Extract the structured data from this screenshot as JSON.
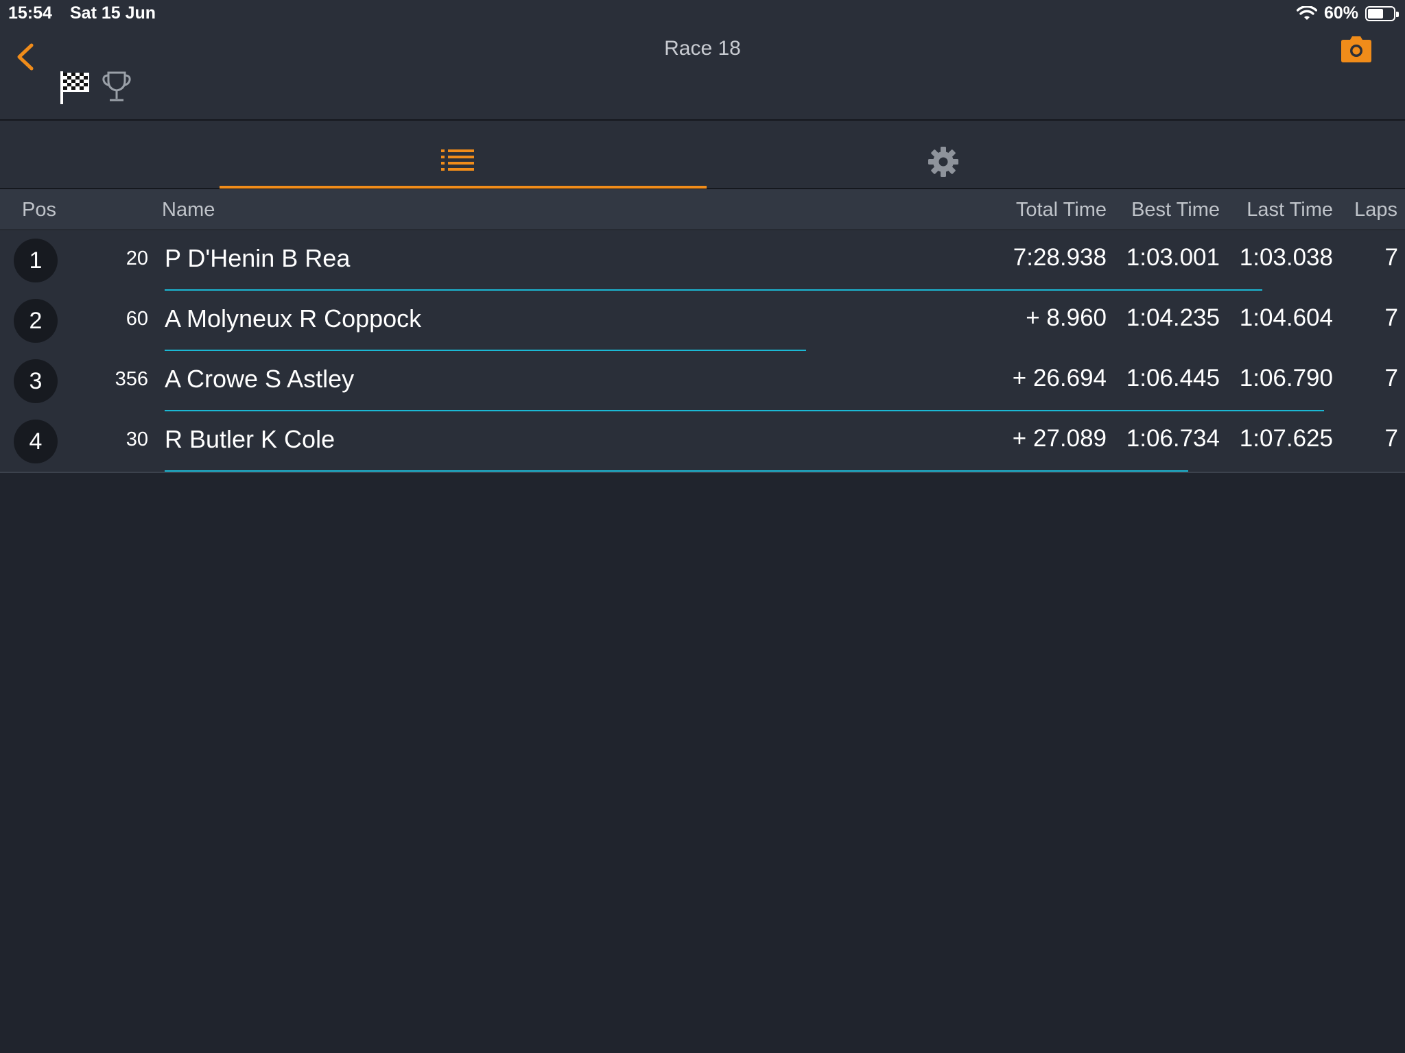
{
  "status_bar": {
    "time": "15:54",
    "date": "Sat 15 Jun",
    "battery": "60%",
    "battery_level": 0.6,
    "icons": [
      "wifi-icon",
      "battery-icon"
    ]
  },
  "nav": {
    "title": "Race 18",
    "icons": [
      "chevron-left-icon",
      "checkered-flag-icon",
      "trophy-icon",
      "camera-icon"
    ]
  },
  "tabs": [
    {
      "icon": "list-icon",
      "selected": true
    },
    {
      "icon": "gear-icon",
      "selected": false
    }
  ],
  "table": {
    "headers": {
      "pos": "Pos",
      "name": "Name",
      "total": "Total Time",
      "best": "Best Time",
      "last": "Last Time",
      "laps": "Laps"
    },
    "rows": [
      {
        "pos": "1",
        "number": "20",
        "name": "P D'Henin B Rea",
        "total": "7:28.938",
        "best": "1:03.001",
        "last": "1:03.038",
        "laps": "7",
        "progress": 0.89
      },
      {
        "pos": "2",
        "number": "60",
        "name": "A Molyneux R Coppock",
        "total": "+ 8.960",
        "best": "1:04.235",
        "last": "1:04.604",
        "laps": "7",
        "progress": 0.52
      },
      {
        "pos": "3",
        "number": "356",
        "name": "A Crowe S Astley",
        "total": "+ 26.694",
        "best": "1:06.445",
        "last": "1:06.790",
        "laps": "7",
        "progress": 0.94
      },
      {
        "pos": "4",
        "number": "30",
        "name": "R Butler K Cole",
        "total": "+ 27.089",
        "best": "1:06.734",
        "last": "1:07.625",
        "laps": "7",
        "progress": 0.83
      }
    ]
  },
  "colors": {
    "accent": "#f08c1a",
    "progress": "#1bb8d4",
    "background": "#20242d",
    "panel": "#2a2f39"
  }
}
